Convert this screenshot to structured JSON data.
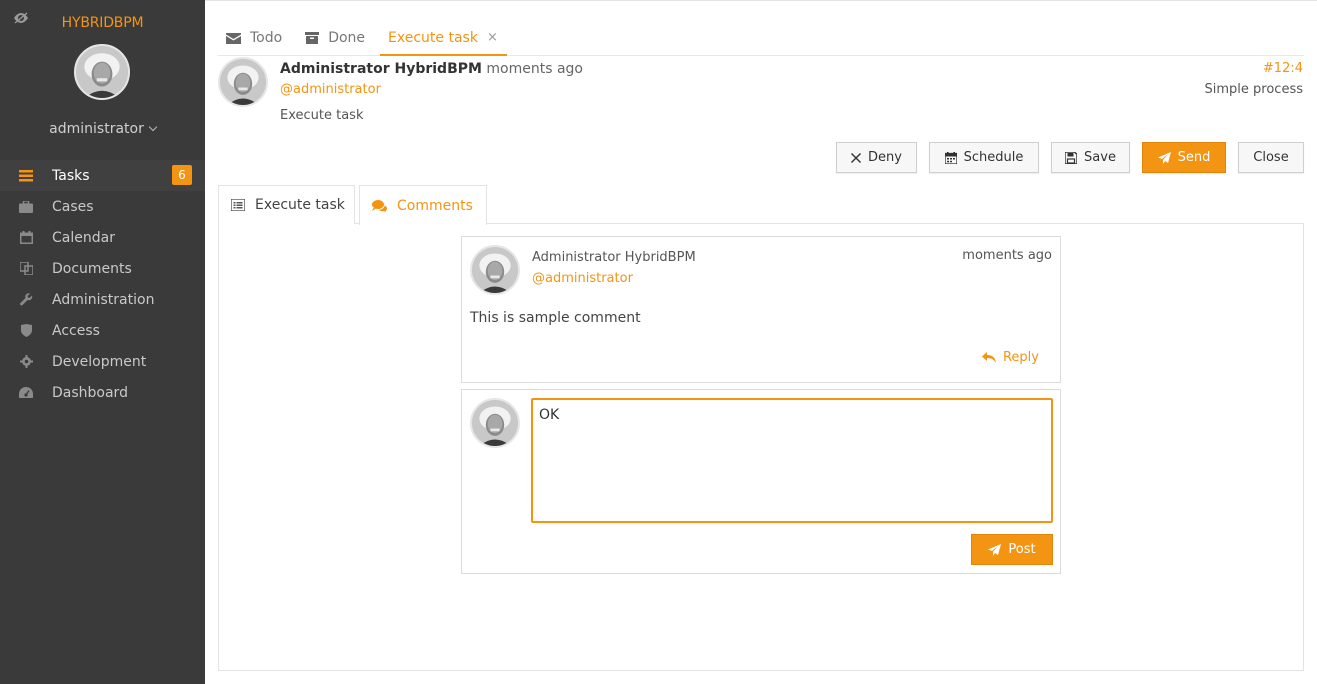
{
  "brand": "HYBRIDBPM",
  "user": {
    "name": "administrator"
  },
  "sidebar": {
    "items": [
      {
        "label": "Tasks",
        "icon": "tasks-icon",
        "badge": "6",
        "active": true
      },
      {
        "label": "Cases",
        "icon": "briefcase-icon"
      },
      {
        "label": "Calendar",
        "icon": "calendar-icon"
      },
      {
        "label": "Documents",
        "icon": "documents-icon"
      },
      {
        "label": "Administration",
        "icon": "wrench-icon"
      },
      {
        "label": "Access",
        "icon": "shield-icon"
      },
      {
        "label": "Development",
        "icon": "gear-icon"
      },
      {
        "label": "Dashboard",
        "icon": "dashboard-icon"
      }
    ]
  },
  "top_tabs": [
    {
      "label": "Todo",
      "icon": "envelope-icon"
    },
    {
      "label": "Done",
      "icon": "archive-icon"
    },
    {
      "label": "Execute task",
      "active": true,
      "close": "×"
    }
  ],
  "task": {
    "author": "Administrator HybridBPM",
    "time": "moments ago",
    "handle": "@administrator",
    "name": "Execute task",
    "id": "#12:4",
    "process": "Simple process"
  },
  "actions": {
    "deny": "Deny",
    "schedule": "Schedule",
    "save": "Save",
    "send": "Send",
    "close": "Close"
  },
  "inner_tabs": [
    {
      "label": "Execute task",
      "icon": "list-icon"
    },
    {
      "label": "Comments",
      "icon": "comments-icon",
      "active": true
    }
  ],
  "comment": {
    "author": "Administrator HybridBPM",
    "handle": "@administrator",
    "time": "moments ago",
    "text": "This is sample comment",
    "reply_label": "Reply"
  },
  "reply": {
    "value": "OK",
    "post_label": "Post"
  },
  "colors": {
    "accent": "#f39412",
    "sidebar_bg": "#3a3a3a"
  }
}
